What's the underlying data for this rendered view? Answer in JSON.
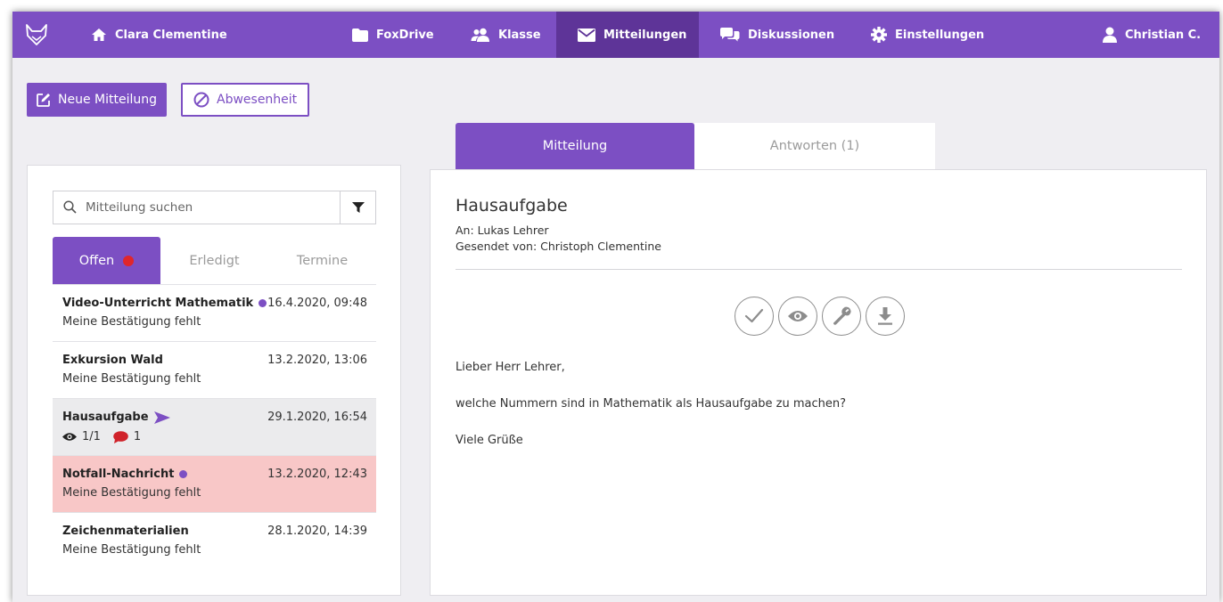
{
  "nav": {
    "home_label": "Clara Clementine",
    "items": [
      {
        "label": "FoxDrive",
        "icon": "folder-icon"
      },
      {
        "label": "Klasse",
        "icon": "users-icon"
      },
      {
        "label": "Mitteilungen",
        "icon": "envelope-icon",
        "active": true
      },
      {
        "label": "Diskussionen",
        "icon": "chat-icon"
      },
      {
        "label": "Einstellungen",
        "icon": "gear-icon"
      }
    ],
    "user_label": "Christian C."
  },
  "toolbar": {
    "new_label": "Neue Mitteilung",
    "absence_label": "Abwesenheit"
  },
  "search": {
    "placeholder": "Mitteilung suchen"
  },
  "list_tabs": [
    {
      "label": "Offen",
      "active": true,
      "has_alert": true
    },
    {
      "label": "Erledigt"
    },
    {
      "label": "Termine"
    }
  ],
  "messages": [
    {
      "title": "Video-Unterricht Mathematik",
      "date": "16.4.2020, 09:48",
      "sub": "Meine Bestätigung fehlt",
      "unread": true
    },
    {
      "title": "Exkursion Wald",
      "date": "13.2.2020, 13:06",
      "sub": "Meine Bestätigung fehlt"
    },
    {
      "title": "Hausaufgabe",
      "date": "29.1.2020, 16:54",
      "views": "1/1",
      "replies": "1",
      "selected": true,
      "sent": true
    },
    {
      "title": "Notfall-Nachricht",
      "date": "13.2.2020, 12:43",
      "sub": "Meine Bestätigung fehlt",
      "unread": true,
      "alert": true
    },
    {
      "title": "Zeichenmaterialien",
      "date": "28.1.2020, 14:39",
      "sub": "Meine Bestätigung fehlt"
    }
  ],
  "detail_tabs": {
    "message": "Mitteilung",
    "replies": "Antworten (1)"
  },
  "detail": {
    "title": "Hausaufgabe",
    "to": "An: Lukas Lehrer",
    "from": "Gesendet von: Christoph Clementine",
    "body": [
      "Lieber Herr Lehrer,",
      "welche Nummern sind in Mathematik als Hausaufgabe zu machen?",
      "Viele Grüße"
    ]
  },
  "colors": {
    "brand": "#7c4fc3",
    "nav_active": "#5e3498",
    "alert_row": "#f8c7c7",
    "alert_dot": "#e0262b"
  }
}
